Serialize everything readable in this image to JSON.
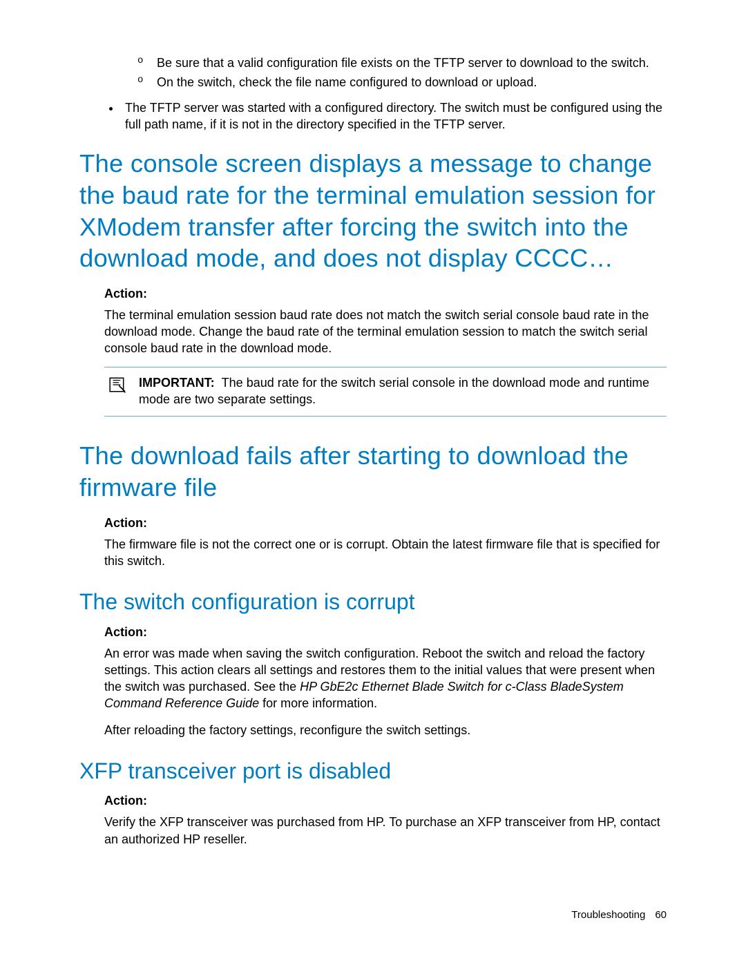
{
  "bullets": {
    "sub1": "Be sure that a valid configuration file exists on the TFTP server to download to the switch.",
    "sub2": "On the switch, check the file name configured to download or upload.",
    "main1": "The TFTP server was started with a configured directory. The switch must be configured using the full path name, if it is not in the directory specified in the TFTP server."
  },
  "section1": {
    "heading": "The console screen displays a message to change the baud rate for the terminal emulation session for XModem transfer after forcing the switch into the download mode, and does not display CCCC…",
    "action_label": "Action:",
    "action_text": "The terminal emulation session baud rate does not match the switch serial console baud rate in the download mode. Change the baud rate of the terminal emulation session to match the switch serial console baud rate in the download mode.",
    "important_label": "IMPORTANT:",
    "important_text": "The baud rate for the switch serial console in the download mode and runtime mode are two separate settings."
  },
  "section2": {
    "heading": "The download fails after starting to download the firmware file",
    "action_label": "Action:",
    "action_text": "The firmware file is not the correct one or is corrupt. Obtain the latest firmware file that is specified for this switch."
  },
  "section3": {
    "heading": "The switch configuration is corrupt",
    "action_label": "Action:",
    "action_text_pre": "An error was made when saving the switch configuration. Reboot the switch and reload the factory settings. This action clears all settings and restores them to the initial values that were present when the switch was purchased. See the ",
    "action_text_italic": "HP GbE2c Ethernet Blade Switch for c-Class BladeSystem Command Reference Guide",
    "action_text_post": " for more information.",
    "action_text2": "After reloading the factory settings, reconfigure the switch settings."
  },
  "section4": {
    "heading": "XFP transceiver port is disabled",
    "action_label": "Action:",
    "action_text": "Verify the XFP transceiver was purchased from HP. To purchase an XFP transceiver from HP, contact an authorized HP reseller."
  },
  "footer": {
    "section": "Troubleshooting",
    "page": "60"
  }
}
